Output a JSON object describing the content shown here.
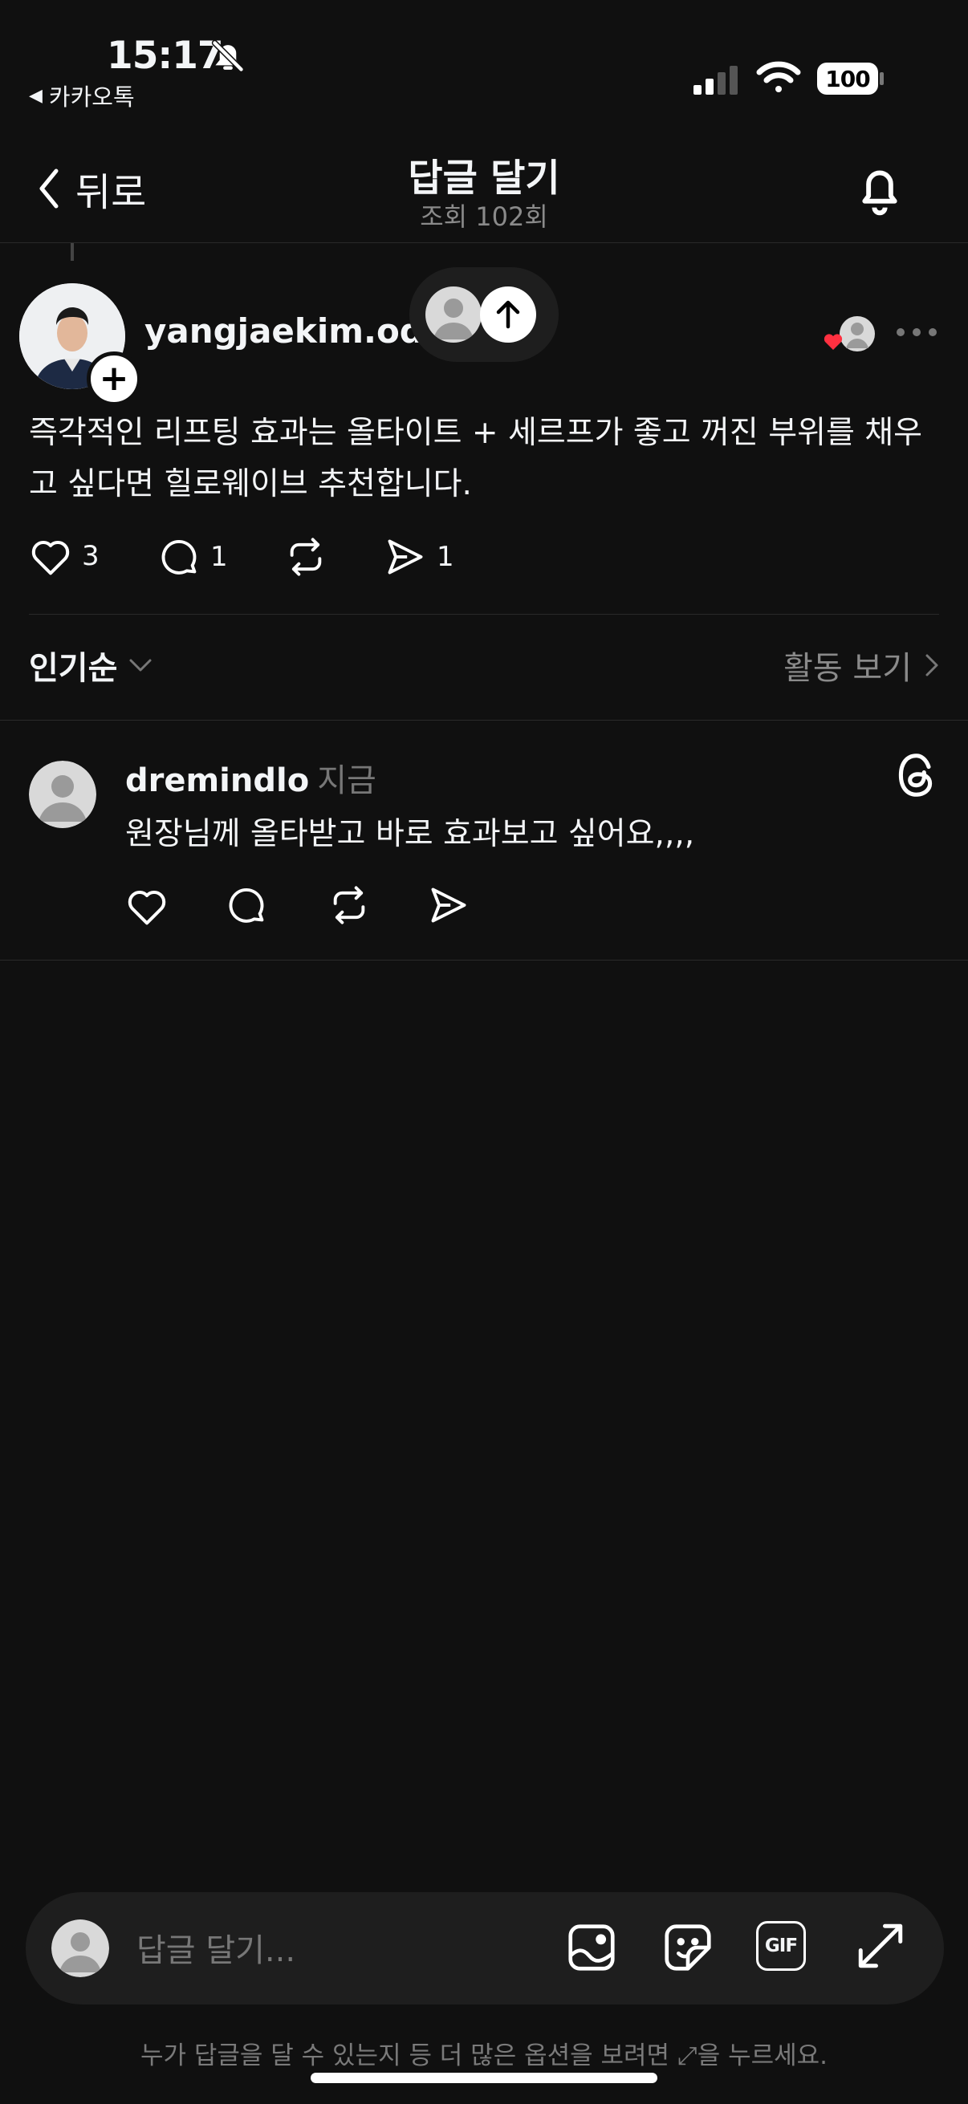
{
  "status_bar": {
    "time": "15:17",
    "back_app": "카카오톡",
    "battery": "100"
  },
  "header": {
    "back_label": "뒤로",
    "title": "답글 달기",
    "subtitle": "조회 102회"
  },
  "post": {
    "username": "yangjaekim.ode",
    "body": "즉각적인 리프팅 효과는 올타이트 + 세르프가 좋고 꺼진 부위를 채우고 싶다면 힐로웨이브 추천합니다.",
    "likes": "3",
    "comments": "1",
    "shares": "1"
  },
  "sort": {
    "label": "인기순",
    "activity_label": "활동 보기"
  },
  "reply": {
    "username": "dremindlo",
    "time": "지금",
    "body": "원장님께 올타받고 바로 효과보고 싶어요,,,,"
  },
  "composer": {
    "placeholder": "답글 달기...",
    "gif_label": "GIF",
    "hint": "누가 답글을 달 수 있는지 등 더 많은 옵션을 보려면 ⤢을 누르세요."
  },
  "colors": {
    "background": "#101010",
    "surface": "#1e1e1e",
    "text": "#f3f5f7",
    "muted": "#777777",
    "like_red": "#ff3040"
  },
  "icons": [
    "bell-slash-icon",
    "cellular-icon",
    "wifi-icon",
    "back-chevron-icon",
    "bell-icon",
    "heart-icon",
    "comment-icon",
    "repost-icon",
    "send-icon",
    "more-icon",
    "threads-icon",
    "image-icon",
    "sticker-icon",
    "gif-icon",
    "expand-icon"
  ]
}
